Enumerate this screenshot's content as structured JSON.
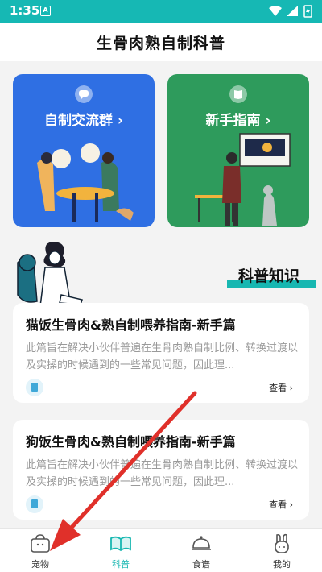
{
  "status": {
    "time": "1:35",
    "notification_letter": "A"
  },
  "header": {
    "title": "生骨肉熟自制科普"
  },
  "banners": [
    {
      "label": "自制交流群 ›",
      "icon": "chat-bubble-icon"
    },
    {
      "label": "新手指南 ›",
      "icon": "map-book-icon"
    }
  ],
  "section": {
    "title": "科普知识"
  },
  "articles": [
    {
      "title": "猫饭生骨肉&熟自制喂养指南-新手篇",
      "desc": "此篇旨在解决小伙伴普遍在生骨肉熟自制比例、转换过渡以及实操的时候遇到的一些常见问题，因此理...",
      "more": "查看 ›"
    },
    {
      "title": "狗饭生骨肉&熟自制喂养指南-新手篇",
      "desc": "此篇旨在解决小伙伴普遍在生骨肉熟自制比例、转换过渡以及实操的时候遇到的一些常见问题，因此理...",
      "more": "查看 ›"
    }
  ],
  "tabs": [
    {
      "label": "宠物",
      "icon": "pet-bag-icon",
      "active": false
    },
    {
      "label": "科普",
      "icon": "open-book-icon",
      "active": true
    },
    {
      "label": "食谱",
      "icon": "food-cloche-icon",
      "active": false
    },
    {
      "label": "我的",
      "icon": "bunny-profile-icon",
      "active": false
    }
  ],
  "colors": {
    "accent": "#17b7b1",
    "status_bar": "#16b8b4",
    "card_blue": "#2f6fe3",
    "card_green": "#2e9b5c",
    "arrow": "#e0302a"
  }
}
